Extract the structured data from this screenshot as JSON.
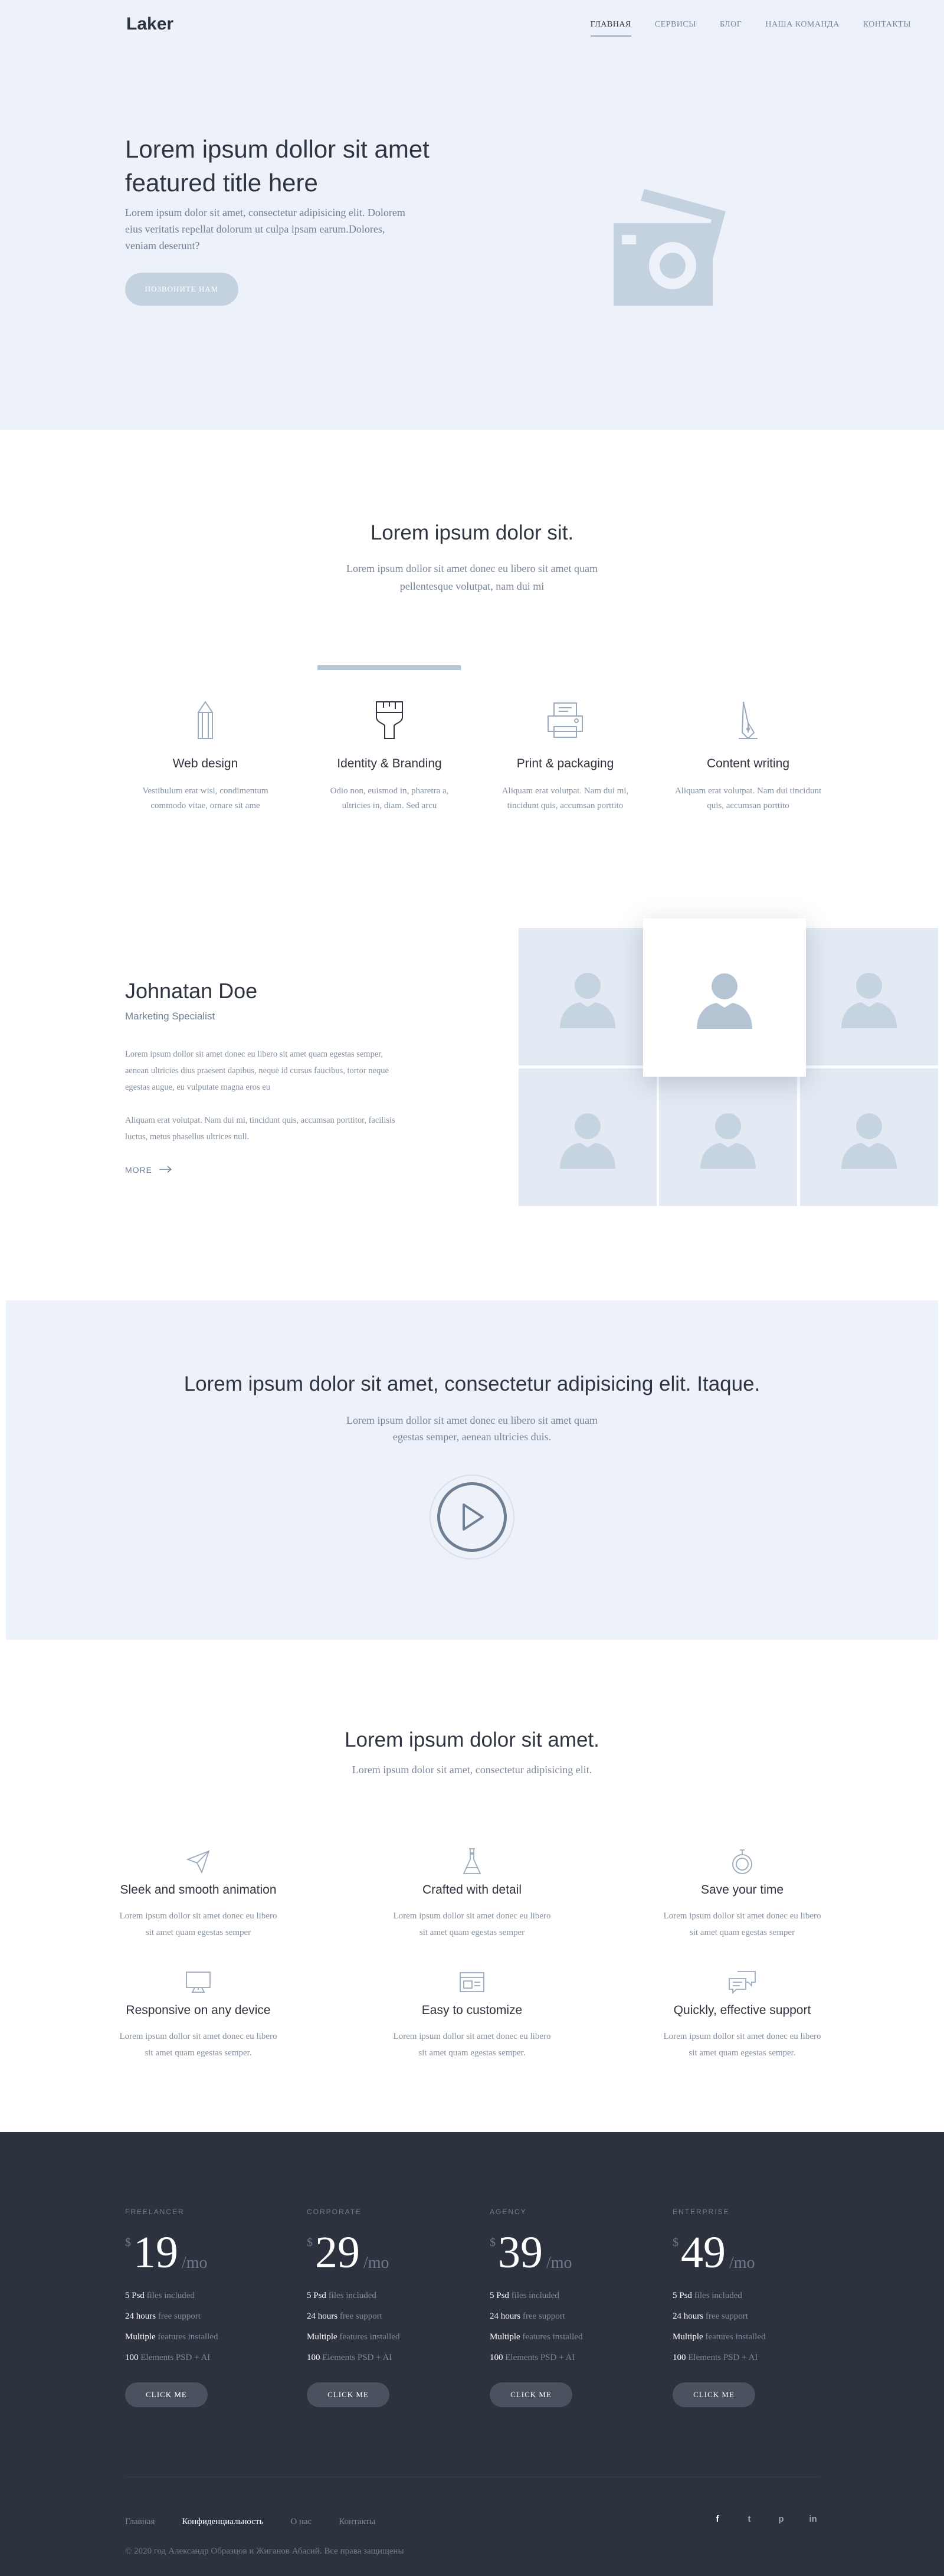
{
  "header": {
    "logo": "Laker",
    "nav": [
      {
        "label": "ГЛАВНАЯ",
        "active": true
      },
      {
        "label": "СЕРВИСЫ",
        "active": false
      },
      {
        "label": "БЛОГ",
        "active": false
      },
      {
        "label": "НАША КОМАНДА",
        "active": false
      },
      {
        "label": "КОНТАКТЫ",
        "active": false
      }
    ]
  },
  "hero": {
    "title": "Lorem ipsum dollor sit amet featured title here",
    "subtitle": "Lorem ipsum dolor sit amet, consectetur adipisicing elit. Dolorem eius veritatis repellat dolorum ut culpa ipsam earum.Dolores, veniam deserunt?",
    "button": "ПОЗВОНИТЕ НАМ",
    "image_icon": "camera-photos-icon"
  },
  "services": {
    "title": "Lorem ipsum dolor sit.",
    "subtitle": "Lorem ipsum dollor sit amet donec eu libero sit amet quam pellentesque volutpat, nam dui mi",
    "items": [
      {
        "title": "Web design",
        "text": "Vestibulum erat wisi, condimentum commodo vitae, ornare sit ame",
        "icon": "pencil-icon"
      },
      {
        "title": "Identity & Branding",
        "text": "Odio non, euismod in, pharetra a, ultricies in, diam. Sed arcu",
        "icon": "paint-brush-icon"
      },
      {
        "title": "Print & packaging",
        "text": "Aliquam erat volutpat. Nam dui mi, tincidunt quis, accumsan porttito",
        "icon": "printer-icon"
      },
      {
        "title": "Content writing",
        "text": "Aliquam erat volutpat. Nam dui tincidunt quis, accumsan porttito",
        "icon": "pen-nib-icon"
      }
    ]
  },
  "profile": {
    "name": "Johnatan Doe",
    "role": "Marketing Specialist",
    "text1": "Lorem ipsum dollor sit amet donec eu libero sit amet quam egestas semper, aenean ultricies dius praesent dapibus, neque id cursus faucibus, tortor neque egestas augue, eu vulputate magna eros eu",
    "text2": "Aliquam erat volutpat. Nam dui mi, tincidunt quis, accumsan porttitor, facilisis luctus, metus phasellus ultrices null.",
    "more": "MORE",
    "avatar_icon": "person-silhouette-icon"
  },
  "video": {
    "title": "Lorem ipsum dolor sit amet, consectetur adipisicing elit. Itaque.",
    "subtitle": "Lorem ipsum dollor sit amet donec eu libero sit amet quam egestas semper, aenean ultricies duis.",
    "play_icon": "play-icon"
  },
  "features": {
    "title": "Lorem ipsum dolor sit amet.",
    "subtitle": "Lorem ipsum dolor sit amet, consectetur adipisicing elit.",
    "items": [
      {
        "title": "Sleek and smooth animation",
        "text": "Lorem ipsum dollor sit amet donec eu libero sit amet quam egestas semper",
        "icon": "paper-plane-icon"
      },
      {
        "title": "Crafted with detail",
        "text": "Lorem ipsum dollor sit amet donec eu libero sit amet quam egestas semper",
        "icon": "flask-icon"
      },
      {
        "title": "Save your time",
        "text": "Lorem ipsum dollor sit amet donec eu libero sit amet quam egestas semper",
        "icon": "stopwatch-icon"
      },
      {
        "title": "Responsive on any device",
        "text": "Lorem ipsum dollor sit amet donec eu libero sit amet quam egestas semper.",
        "icon": "monitor-icon"
      },
      {
        "title": "Easy to customize",
        "text": "Lorem ipsum dollor sit amet donec eu libero sit amet quam egestas semper.",
        "icon": "window-layout-icon"
      },
      {
        "title": "Quickly, effective support",
        "text": "Lorem ipsum dollor sit amet donec eu libero sit amet quam egestas semper.",
        "icon": "chat-bubbles-icon"
      }
    ]
  },
  "pricing": {
    "currency": "$",
    "period": "/mo",
    "button": "CLICK ME",
    "plans": [
      {
        "name": "FREELANCER",
        "price": "19",
        "files": "5 Psd",
        "support": "24 hours",
        "features": "Multiple",
        "elements": "100"
      },
      {
        "name": "CORPORATE",
        "price": "29",
        "files": "5 Psd",
        "support": "24 hours",
        "features": "Multiple",
        "elements": "100"
      },
      {
        "name": "AGENCY",
        "price": "39",
        "files": "5 Psd",
        "support": "24 hours",
        "features": "Multiple",
        "elements": "100"
      },
      {
        "name": "ENTERPRISE",
        "price": "49",
        "files": "5 Psd",
        "support": "24 hours",
        "features": "Multiple",
        "elements": "100"
      }
    ],
    "labels": {
      "files": "files included",
      "support": "free support",
      "features": "features installed",
      "elements": "Elements PSD + AI"
    }
  },
  "footer": {
    "links": [
      {
        "label": "Главная",
        "active": false
      },
      {
        "label": "Конфиденциальность",
        "active": true
      },
      {
        "label": "О нас",
        "active": false
      },
      {
        "label": "Контакты",
        "active": false
      }
    ],
    "copyright": "© 2020 год Александр Образцов и Жиганов Абасий. Все права защищены",
    "socials": [
      {
        "name": "facebook-icon",
        "glyph": "f"
      },
      {
        "name": "twitter-icon",
        "glyph": "t"
      },
      {
        "name": "pinterest-icon",
        "glyph": "p"
      },
      {
        "name": "linkedin-icon",
        "glyph": "in"
      }
    ]
  },
  "colors": {
    "hero_bg": "#edf2fa",
    "dark_bg": "#2d333e",
    "text_dark": "#2e3440",
    "text_muted": "#7a8698",
    "accent": "#b5c6d4"
  }
}
